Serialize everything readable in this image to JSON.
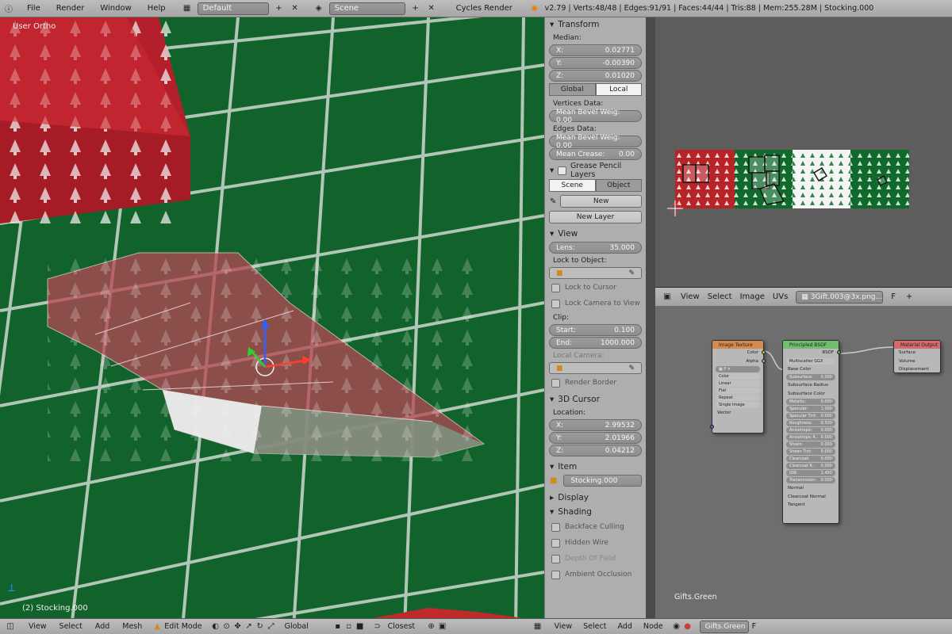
{
  "topbar": {
    "menu": [
      "File",
      "Render",
      "Window",
      "Help"
    ],
    "layout": "Default",
    "scene": "Scene",
    "engine": "Cycles Render",
    "stats": "v2.79 | Verts:48/48 | Edges:91/91 | Faces:44/44 | Tris:88 | Mem:255.28M | Stocking.000"
  },
  "viewport": {
    "view_label": "User Ortho",
    "object_label": "(2) Stocking.000"
  },
  "props": {
    "transform": "Transform",
    "median": "Median:",
    "coords": [
      {
        "k": "X:",
        "v": "0.02771"
      },
      {
        "k": "Y:",
        "v": "-0.00390"
      },
      {
        "k": "Z:",
        "v": "0.01020"
      }
    ],
    "space": [
      "Global",
      "Local"
    ],
    "vertices_data": "Vertices Data:",
    "v_bevel": "Mean Bevel Weig: 0.00",
    "edges_data": "Edges Data:",
    "e_bevel": "Mean Bevel Weig: 0.00",
    "e_crease": {
      "k": "Mean Crease:",
      "v": "0.00"
    },
    "grease": "Grease Pencil Layers",
    "gp_tabs": [
      "Scene",
      "Object"
    ],
    "gp_new": "New",
    "gp_new_layer": "New Layer",
    "view": "View",
    "lens": {
      "k": "Lens:",
      "v": "35.000"
    },
    "lock_obj": "Lock to Object:",
    "lock_cursor": "Lock to Cursor",
    "lock_camera": "Lock Camera to View",
    "clip": "Clip:",
    "clip_start": {
      "k": "Start:",
      "v": "0.100"
    },
    "clip_end": {
      "k": "End:",
      "v": "1000.000"
    },
    "local_camera": "Local Camera:",
    "render_border": "Render Border",
    "cursor": "3D Cursor",
    "location": "Location:",
    "cursor_coords": [
      {
        "k": "X:",
        "v": "2.99532"
      },
      {
        "k": "Y:",
        "v": "2.01966"
      },
      {
        "k": "Z:",
        "v": "0.04212"
      }
    ],
    "item": "Item",
    "item_name": "Stocking.000",
    "display": "Display",
    "shading": "Shading",
    "shading_opts": [
      "Backface Culling",
      "Hidden Wire",
      "Depth Of Field",
      "Ambient Occlusion"
    ]
  },
  "uv_header": {
    "items": [
      "View",
      "Select",
      "Image",
      "UVs"
    ],
    "image": "3Gift.003@3x.png...",
    "f": "F"
  },
  "node_editor": {
    "material": "Gifts.Green",
    "tex_node": {
      "title": "Image Texture",
      "outs": [
        "Color",
        "Alpha"
      ],
      "opts": [
        "Color",
        "Linear",
        "Flat",
        "Repeat",
        "Single Image"
      ],
      "in": "Vector"
    },
    "bsdf_node": {
      "title": "Principled BSDF",
      "out": "BSDF",
      "dist": "Multiscatter GGX",
      "rows": [
        {
          "k": "Base Color",
          "v": ""
        },
        {
          "k": "Subsurface:",
          "v": "0.000"
        },
        {
          "k": "Subsurface Radius",
          "v": ""
        },
        {
          "k": "Subsurface Color",
          "v": ""
        },
        {
          "k": "Metallic:",
          "v": "0.000"
        },
        {
          "k": "Specular:",
          "v": "1.000"
        },
        {
          "k": "Specular Tint:",
          "v": "0.000"
        },
        {
          "k": "Roughness:",
          "v": "0.500"
        },
        {
          "k": "Anisotropic:",
          "v": "0.000"
        },
        {
          "k": "Anisotropic R.:",
          "v": "0.000"
        },
        {
          "k": "Sheen:",
          "v": "0.000"
        },
        {
          "k": "Sheen Tint:",
          "v": "0.000"
        },
        {
          "k": "Clearcoat:",
          "v": "0.000"
        },
        {
          "k": "Clearcoat R.:",
          "v": "0.000"
        },
        {
          "k": "IOR:",
          "v": "1.450"
        },
        {
          "k": "Transmission:",
          "v": "0.000"
        },
        {
          "k": "Normal",
          "v": ""
        },
        {
          "k": "Clearcoat Normal",
          "v": ""
        },
        {
          "k": "Tangent",
          "v": ""
        }
      ]
    },
    "out_node": {
      "title": "Material Output",
      "ins": [
        "Surface",
        "Volume",
        "Displacement"
      ]
    }
  },
  "bottom": {
    "left": [
      "View",
      "Select",
      "Add",
      "Mesh"
    ],
    "mode": "Edit Mode",
    "orient": "Global",
    "snap": "Closest",
    "right": [
      "View",
      "Select",
      "Add",
      "Node"
    ],
    "material": "Gifts.Green",
    "f": "F"
  }
}
